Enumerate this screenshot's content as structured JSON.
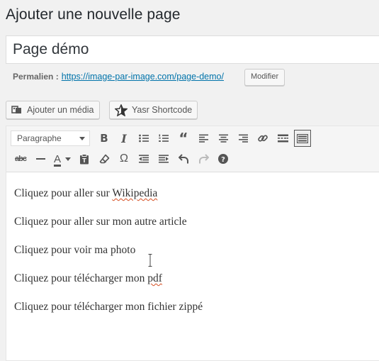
{
  "header": {
    "title": "Ajouter une nouvelle page"
  },
  "post": {
    "title_value": "Page démo"
  },
  "permalink": {
    "label": "Permalien :",
    "url": "https://image-par-image.com/page-demo/",
    "edit_button": "Modifier"
  },
  "media_buttons": {
    "add_media": "Ajouter un média",
    "shortcode": "Yasr Shortcode"
  },
  "toolbar": {
    "format_select": "Paragraphe",
    "row1_icons": [
      "bold-icon",
      "italic-icon",
      "bullet-list-icon",
      "numbered-list-icon",
      "blockquote-icon",
      "align-left-icon",
      "align-center-icon",
      "align-right-icon",
      "link-icon",
      "read-more-icon",
      "toolbar-toggle-icon"
    ],
    "row2_icons": [
      "strikethrough-icon",
      "horizontal-line-icon",
      "text-color-icon",
      "paste-text-icon",
      "clear-formatting-icon",
      "special-character-icon",
      "outdent-icon",
      "indent-icon",
      "undo-icon",
      "redo-icon",
      "help-icon"
    ]
  },
  "content": {
    "lines": [
      {
        "before": "Cliquez pour aller sur ",
        "misspelled": "Wikipedia",
        "after": ""
      },
      {
        "before": "Cliquez pour aller sur mon autre article",
        "misspelled": "",
        "after": ""
      },
      {
        "before": "Cliquez pour voir ma photo",
        "misspelled": "",
        "after": ""
      },
      {
        "before": "Cliquez pour télécharger mon ",
        "misspelled": "pdf",
        "after": ""
      },
      {
        "before": "Cliquez pour télécharger mon fichier zippé",
        "misspelled": "",
        "after": ""
      }
    ]
  }
}
